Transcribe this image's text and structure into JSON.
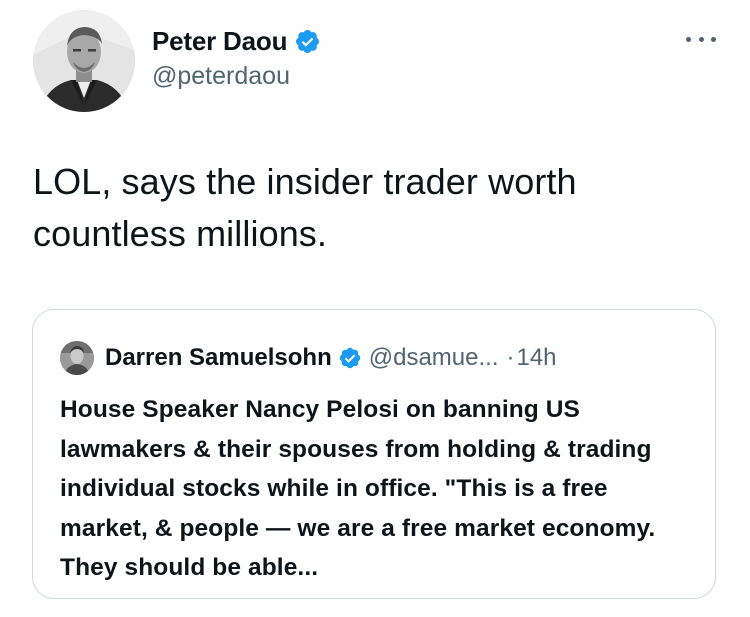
{
  "author": {
    "display_name": "Peter Daou",
    "handle": "@peterdaou",
    "verified": true,
    "avatar_icon": "profile-photo-avatar"
  },
  "tweet": {
    "text": "LOL, says the insider trader worth countless millions."
  },
  "more_icon": "more-options-icon",
  "quoted_tweet": {
    "author_name": "Darren Samuelsohn",
    "handle": "@dsamue...",
    "separator": "·",
    "time": "14h",
    "verified": true,
    "text": "House Speaker Nancy Pelosi on banning US lawmakers & their spouses from holding & trading individual stocks while in office. \"This is a free market, & people — we are a free market economy. They should be able..."
  },
  "colors": {
    "verified_blue": "#1d9bf0",
    "text_primary": "#0f1419",
    "text_secondary": "#536471",
    "border": "#cfd9de"
  }
}
